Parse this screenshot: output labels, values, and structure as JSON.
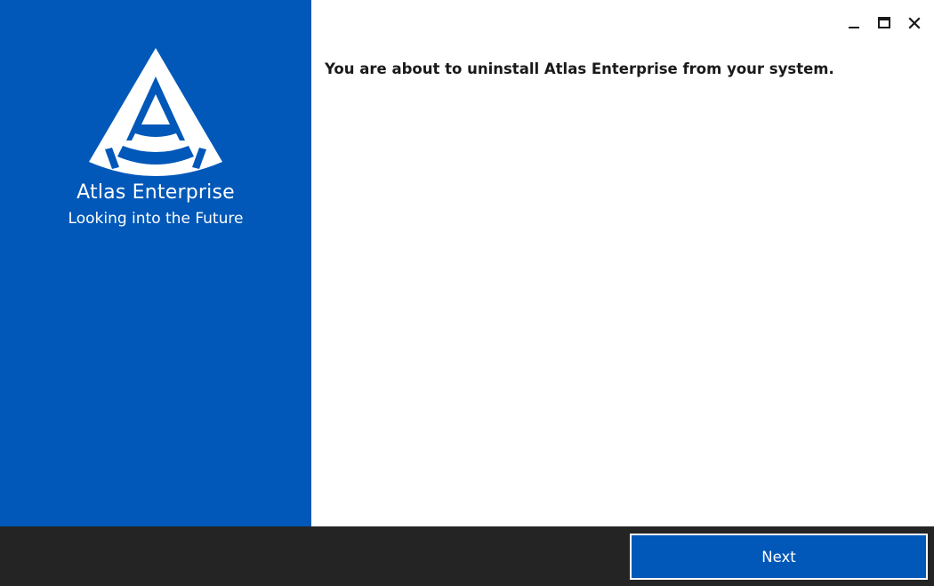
{
  "sidebar": {
    "logo_icon": "atlas-a-logo-icon",
    "app_name": "Atlas Enterprise",
    "tagline": "Looking into the Future",
    "background_color": "#0158b8"
  },
  "window_controls": {
    "minimize_icon": "minimize-icon",
    "maximize_icon": "maximize-icon",
    "close_icon": "close-icon"
  },
  "content": {
    "message": "You are about to uninstall Atlas Enterprise from your system."
  },
  "footer": {
    "next_label": "Next",
    "background_color": "#242424",
    "button_color": "#0158b8"
  }
}
